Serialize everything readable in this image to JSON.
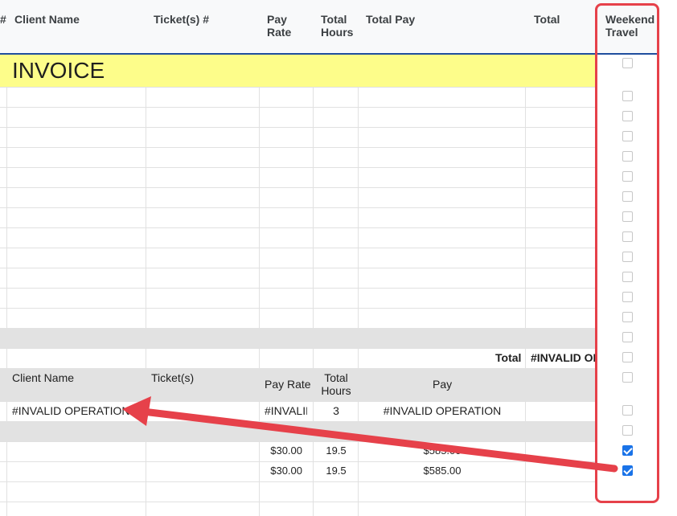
{
  "header": {
    "row_num_mark": "#",
    "client_name": "Client Name",
    "tickets": "Ticket(s) #",
    "pay_rate": "Pay\nRate",
    "total_hours": "Total\nHours",
    "total_pay": "Total Pay",
    "total": "Total",
    "weekend_travel": "Weekend\nTravel"
  },
  "invoice_title": "INVOICE",
  "totals_row": {
    "label": "Total",
    "value": "#INVALID OPERATION"
  },
  "sub_header": {
    "client_name": "Client Name",
    "tickets": "Ticket(s)",
    "pay_rate": "Pay Rate",
    "total_hours": "Total\nHours",
    "pay": "Pay"
  },
  "data_row": {
    "client_name": "#INVALID OPERATION",
    "pay_rate": "#INVALID OPERATION",
    "total_hours": "3",
    "pay": "#INVALID OPERATION"
  },
  "pay_rows": [
    {
      "pay_rate": "$30.00",
      "total_hours": "19.5",
      "pay": "$585.00"
    },
    {
      "pay_rate": "$30.00",
      "total_hours": "19.5",
      "pay": "$585.00"
    }
  ],
  "weekend_travel_checks": [
    false,
    false,
    false,
    false,
    false,
    false,
    false,
    false,
    false,
    false,
    false,
    false,
    false,
    false,
    false,
    false,
    false,
    false,
    false,
    true,
    true
  ],
  "colors": {
    "invoice_band": "#fdfd8a",
    "gray_band": "#e2e2e2",
    "checkbox_on": "#1a73e8",
    "annotation": "#e6414a"
  }
}
